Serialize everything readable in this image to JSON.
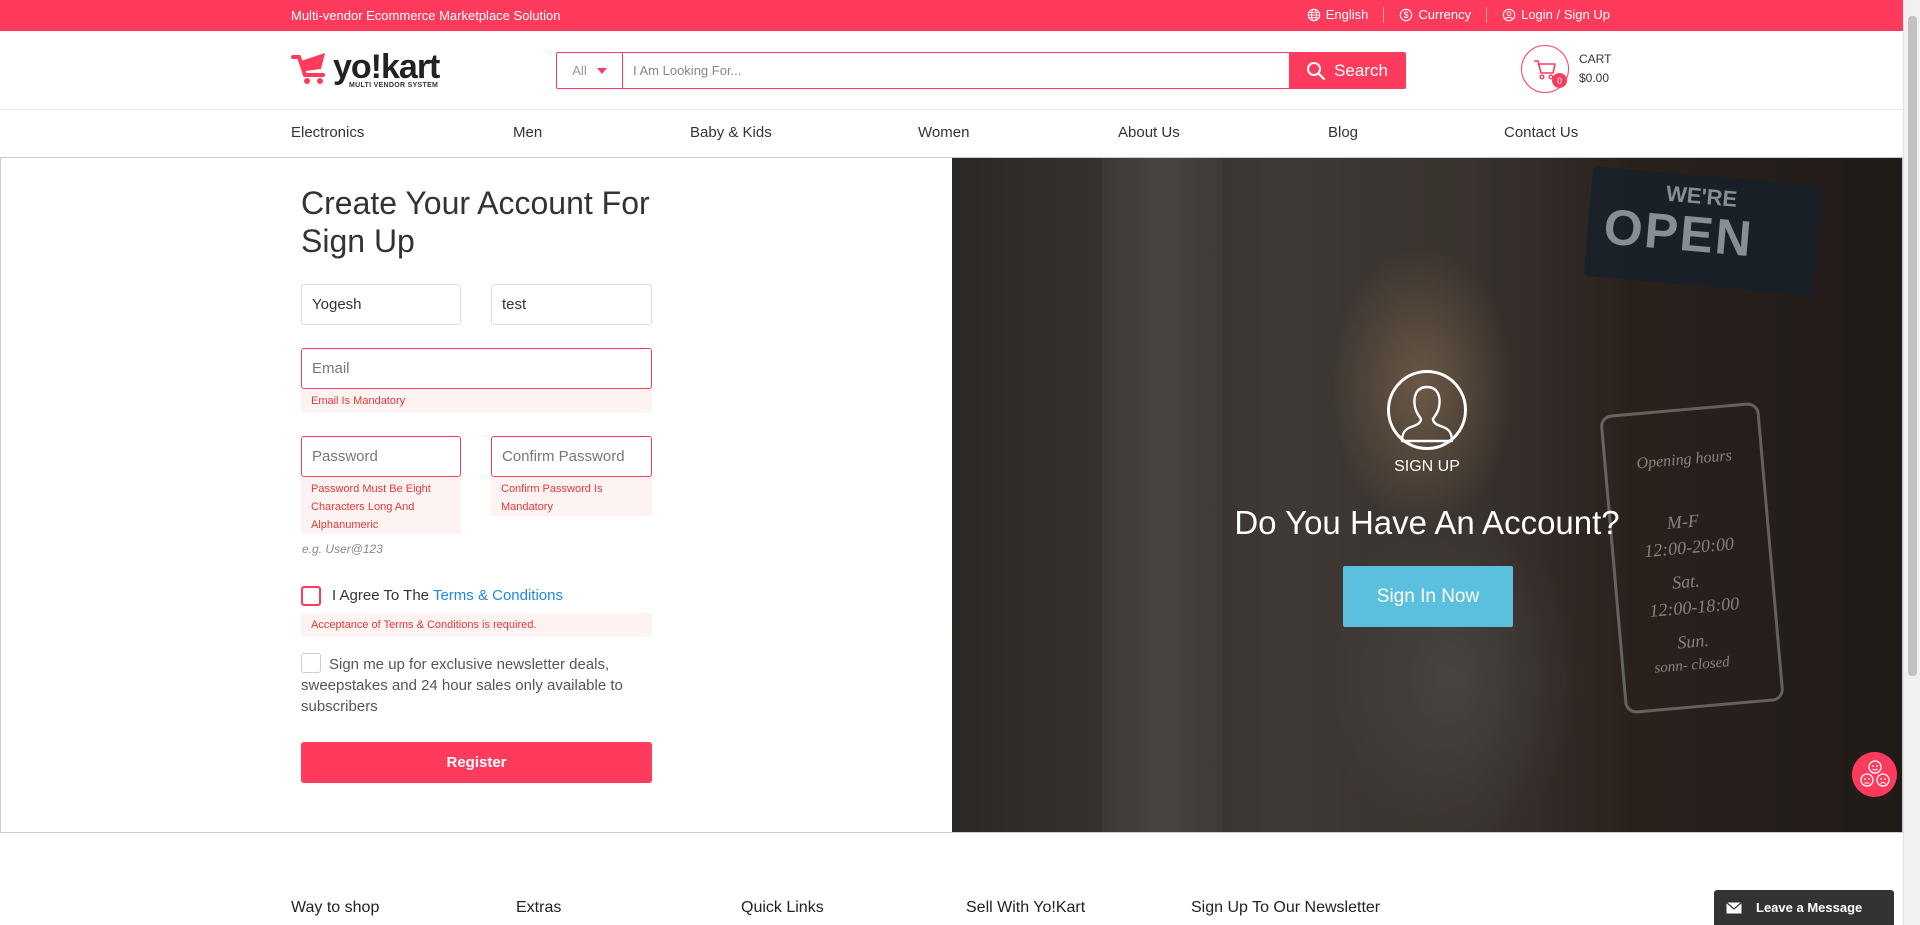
{
  "topbar": {
    "tagline": "Multi-vendor Ecommerce Marketplace Solution",
    "language": "English",
    "currency": "Currency",
    "login": "Login / Sign Up"
  },
  "header": {
    "logo_brand": "yo!kart",
    "logo_sub": "MULTI VENDOR SYSTEM",
    "search_category": "All",
    "search_placeholder": "I Am Looking For...",
    "search_button": "Search",
    "cart_label": "CART",
    "cart_total": "$0.00",
    "cart_count": "0"
  },
  "nav": [
    "Electronics",
    "Men",
    "Baby & Kids",
    "Women",
    "About Us",
    "Blog",
    "Contact Us"
  ],
  "form": {
    "title": "Create Your Account For Sign Up",
    "first_name_value": "Yogesh",
    "last_name_value": "test",
    "email_placeholder": "Email",
    "email_error": "Email Is Mandatory",
    "password_placeholder": "Password",
    "password_error": "Password Must Be Eight Characters Long And Alphanumeric",
    "confirm_placeholder": "Confirm Password",
    "confirm_error": "Confirm Password Is Mandatory",
    "password_hint": "e.g. User@123",
    "agree_text": "I Agree To The",
    "terms_link": "Terms & Conditions",
    "terms_error": "Acceptance of Terms & Conditions is required.",
    "newsletter_text": "Sign me up for exclusive newsletter deals, sweepstakes and 24 hour sales only available to subscribers",
    "register_button": "Register"
  },
  "promo": {
    "signup_label": "SIGN UP",
    "question": "Do You Have An Account?",
    "signin_button": "Sign In Now",
    "sign_small": "WE'RE",
    "sign_big": "OPEN",
    "hours_title": "Opening hours",
    "hours_days": "M-F",
    "hours_time": "12:00-20:00",
    "hours_sat": "Sat.",
    "hours_sat_time": "12:00-18:00",
    "hours_sun": "Sun.",
    "hours_sun_note": "sonn- closed"
  },
  "footer": {
    "columns": [
      "Way to shop",
      "Extras",
      "Quick Links",
      "Sell With Yo!Kart",
      "Sign Up To Our Newsletter"
    ]
  },
  "chat": {
    "leave_message": "Leave a Message"
  },
  "colors": {
    "brand": "#fe3b5c",
    "signin": "#5bc0de",
    "link": "#1e88e5"
  },
  "icons": [
    "globe-icon",
    "currency-icon",
    "user-icon",
    "search-icon",
    "cart-icon",
    "avatar-icon",
    "emoji-icon",
    "envelope-icon"
  ]
}
